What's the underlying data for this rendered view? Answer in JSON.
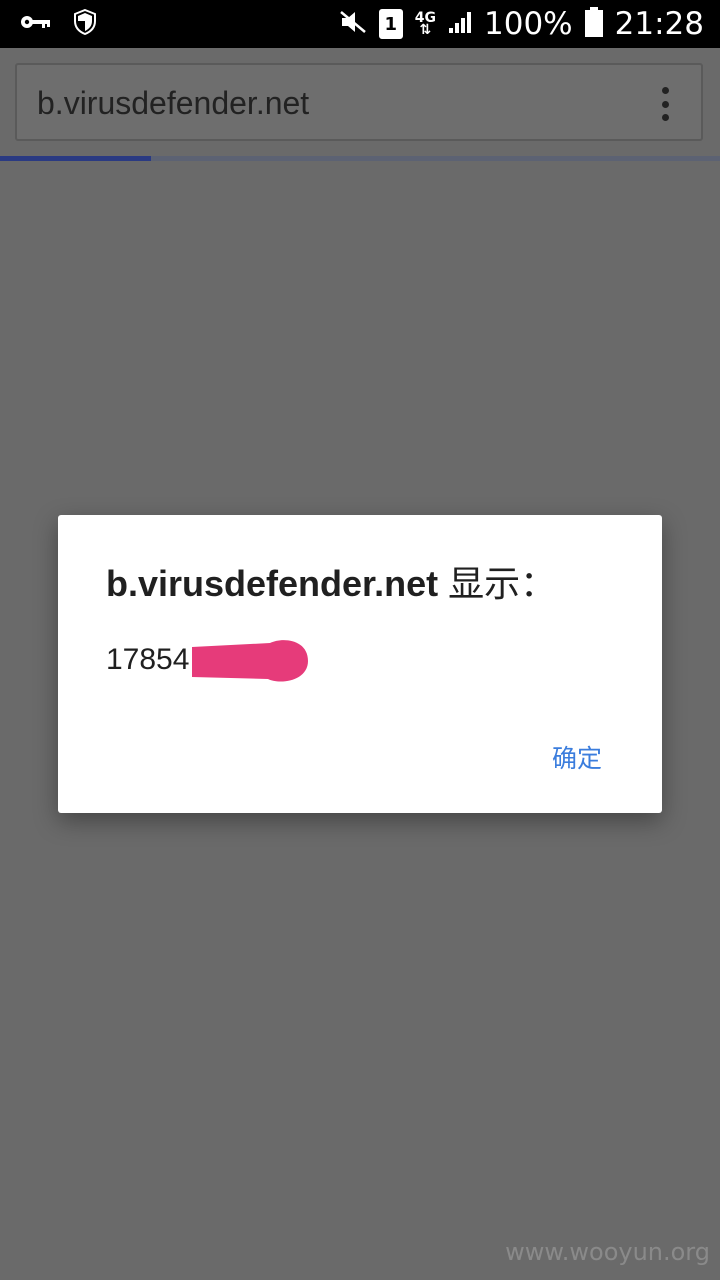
{
  "status_bar": {
    "sim_slot": "1",
    "network_type": "4G",
    "battery_percent": "100%",
    "time": "21:28",
    "icons": [
      "key-icon",
      "shield-icon",
      "mute-icon",
      "sim-icon",
      "network-arrows-icon",
      "signal-icon",
      "battery-icon"
    ]
  },
  "browser": {
    "url": "b.virusdefender.net",
    "load_progress": 0.21,
    "menu_icon": "overflow-menu-icon"
  },
  "dialog": {
    "title_host": "b.virusdefender.net",
    "title_suffix": "显示：",
    "message": "17854",
    "ok_label": "确定",
    "redaction_color": "#e63b7a"
  },
  "watermark": "www.wooyun.org",
  "colors": {
    "accent": "#3b7ddd",
    "overlay": "#6a6a6a"
  }
}
